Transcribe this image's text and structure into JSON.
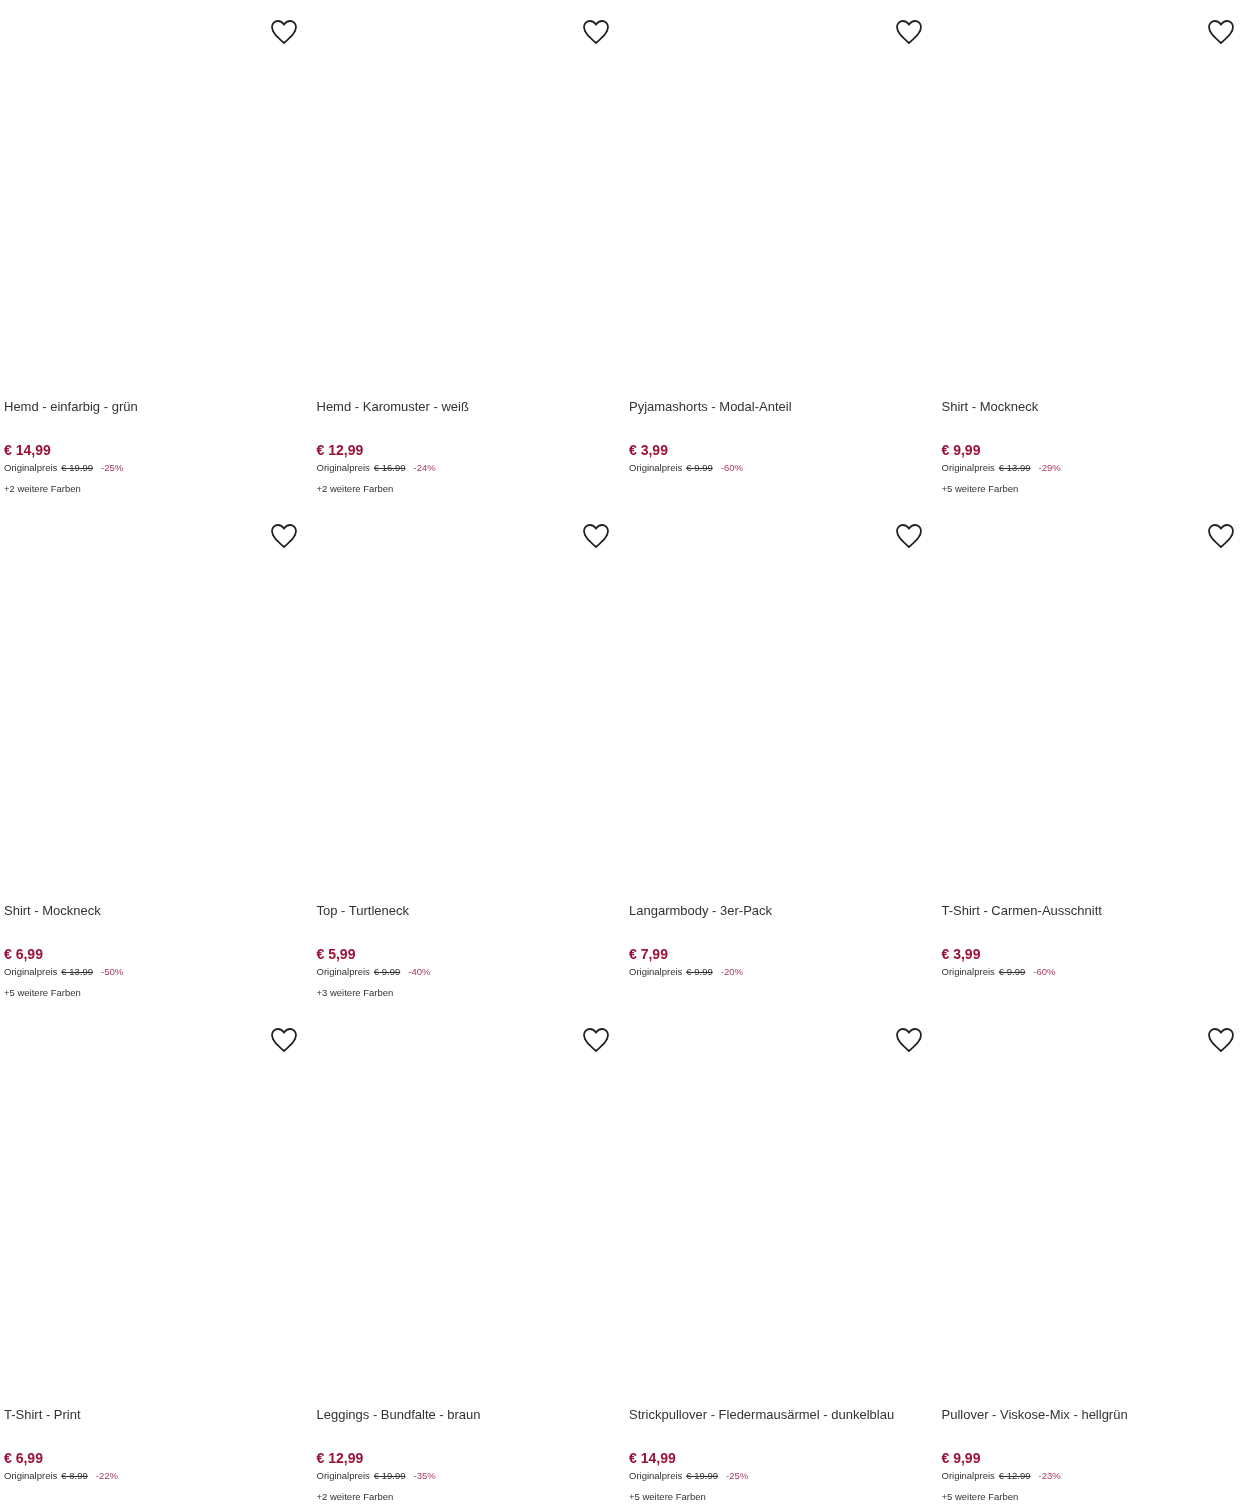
{
  "products": [
    {
      "title": "Hemd - einfarbig - grün",
      "price": "€ 14,99",
      "original_label": "Originalpreis",
      "original_price": "€ 19.99",
      "discount": "-25%",
      "more_colors": "+2 weitere Farben"
    },
    {
      "title": "Hemd - Karomuster - weiß",
      "price": "€ 12,99",
      "original_label": "Originalpreis",
      "original_price": "€ 16.99",
      "discount": "-24%",
      "more_colors": "+2 weitere Farben"
    },
    {
      "title": "Pyjamashorts - Modal-Anteil",
      "price": "€ 3,99",
      "original_label": "Originalpreis",
      "original_price": "€ 9.99",
      "discount": "-60%"
    },
    {
      "title": "Shirt - Mockneck",
      "price": "€ 9,99",
      "original_label": "Originalpreis",
      "original_price": "€ 13.99",
      "discount": "-29%",
      "more_colors": "+5 weitere Farben"
    },
    {
      "title": "Shirt - Mockneck",
      "price": "€ 6,99",
      "original_label": "Originalpreis",
      "original_price": "€ 13.99",
      "discount": "-50%",
      "more_colors": "+5 weitere Farben"
    },
    {
      "title": "Top - Turtleneck",
      "price": "€ 5,99",
      "original_label": "Originalpreis",
      "original_price": "€ 9.99",
      "discount": "-40%",
      "more_colors": "+3 weitere Farben"
    },
    {
      "title": "Langarmbody - 3er-Pack",
      "price": "€ 7,99",
      "original_label": "Originalpreis",
      "original_price": "€ 9.99",
      "discount": "-20%"
    },
    {
      "title": "T-Shirt - Carmen-Ausschnitt",
      "price": "€ 3,99",
      "original_label": "Originalpreis",
      "original_price": "€ 9.99",
      "discount": "-60%"
    },
    {
      "title": "T-Shirt - Print",
      "price": "€ 6,99",
      "original_label": "Originalpreis",
      "original_price": "€ 8.99",
      "discount": "-22%"
    },
    {
      "title": "Leggings - Bundfalte - braun",
      "price": "€ 12,99",
      "original_label": "Originalpreis",
      "original_price": "€ 19.99",
      "discount": "-35%",
      "more_colors": "+2 weitere Farben"
    },
    {
      "title": "Strickpullover - Fledermausärmel - dunkelblau",
      "price": "€ 14,99",
      "original_label": "Originalpreis",
      "original_price": "€ 19.99",
      "discount": "-25%",
      "more_colors": "+5 weitere Farben"
    },
    {
      "title": "Pullover - Viskose-Mix - hellgrün",
      "price": "€ 9,99",
      "original_label": "Originalpreis",
      "original_price": "€ 12.99",
      "discount": "-23%",
      "more_colors": "+5 weitere Farben"
    }
  ]
}
